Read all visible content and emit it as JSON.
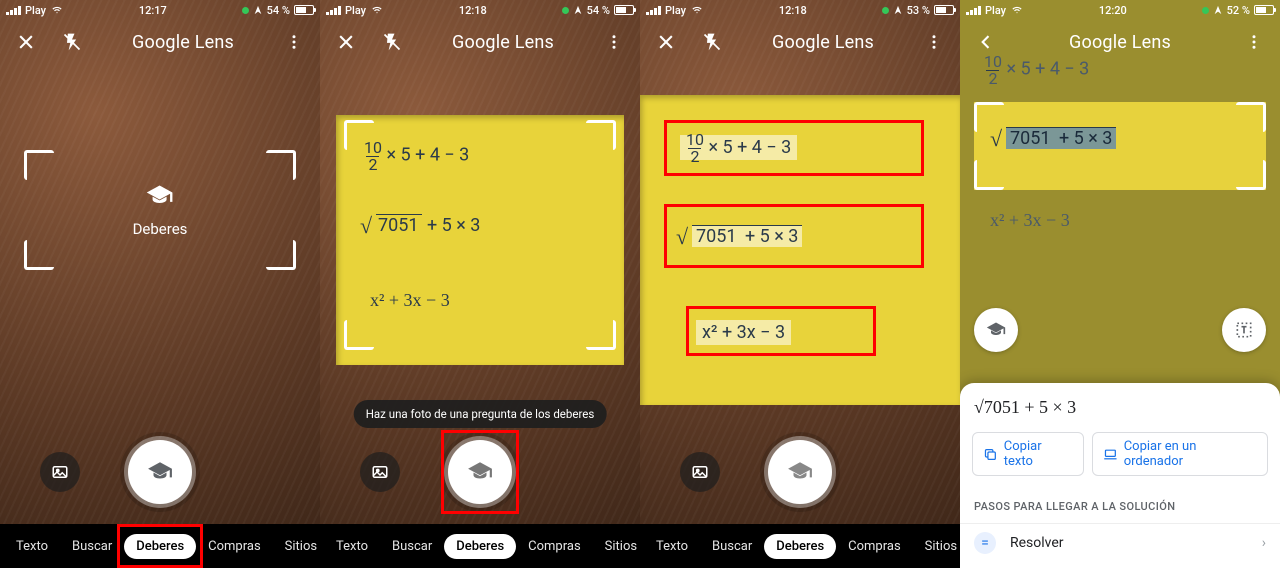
{
  "shared": {
    "carrier": "Play",
    "app_title": "Google Lens",
    "modes": [
      "Texto",
      "Buscar",
      "Deberes",
      "Compras",
      "Sitios"
    ],
    "active_mode": "Deberes",
    "equations": {
      "eq1_numerator": "10",
      "eq1_denominator": "2",
      "eq1_rest": "× 5 + 4 − 3",
      "eq2_root": "7051",
      "eq2_rest": "+ 5 × 3",
      "eq3": "x² + 3x − 3"
    }
  },
  "screen1": {
    "time": "12:17",
    "battery": "54 %",
    "center_label": "Deberes"
  },
  "screen2": {
    "time": "12:18",
    "battery": "54 %",
    "tooltip": "Haz una foto de una pregunta de los deberes"
  },
  "screen3": {
    "time": "12:18",
    "battery": "53 %"
  },
  "screen4": {
    "time": "12:20",
    "battery": "52 %",
    "math_display": "√7051 + 5 × 3",
    "chip_copy": "Copiar texto",
    "chip_copy_pc": "Copiar en un ordenador",
    "section": "PASOS PARA LLEGAR A LA SOLUCIÓN",
    "solve": "Resolver"
  }
}
